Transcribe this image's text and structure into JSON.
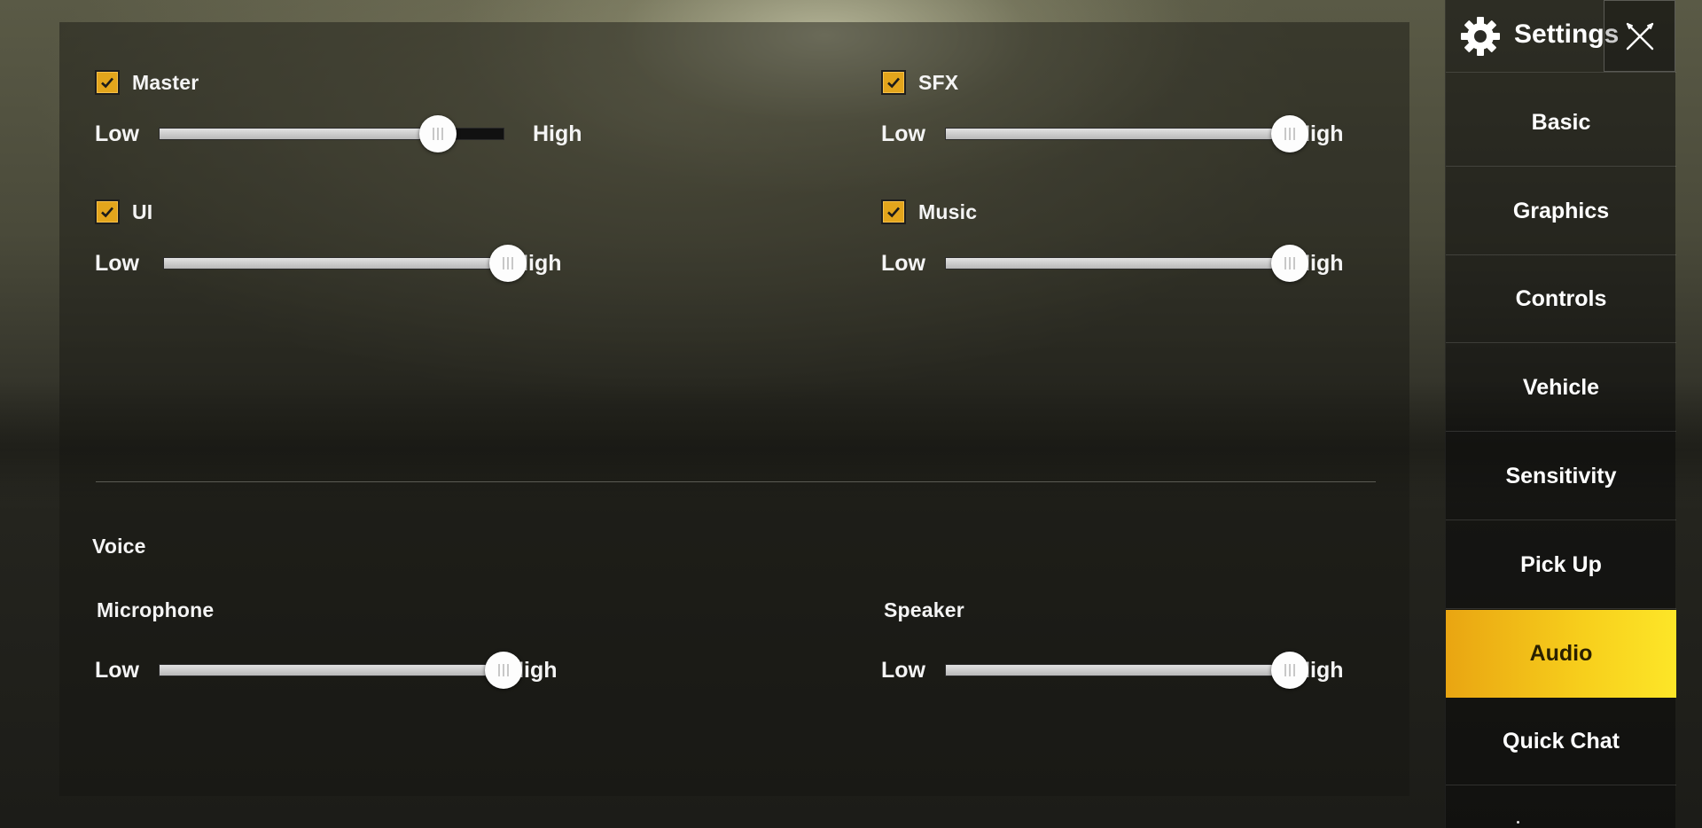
{
  "audio": {
    "master": {
      "label": "Master",
      "checked": true,
      "low": "Low",
      "high": "High",
      "level": 0.81
    },
    "sfx": {
      "label": "SFX",
      "checked": true,
      "low": "Low",
      "high": "High",
      "level": 1.0
    },
    "ui": {
      "label": "UI",
      "checked": true,
      "low": "Low",
      "high": "High",
      "level": 1.0
    },
    "music": {
      "label": "Music",
      "checked": true,
      "low": "Low",
      "high": "High",
      "level": 1.0
    }
  },
  "voice": {
    "section_label": "Voice",
    "microphone": {
      "label": "Microphone",
      "low": "Low",
      "high": "High",
      "level": 1.0
    },
    "speaker": {
      "label": "Speaker",
      "low": "Low",
      "high": "High",
      "level": 1.0
    }
  },
  "sidebar": {
    "title": "Settings",
    "header_icon": "gear-icon",
    "close_icon": "close-icon",
    "items": [
      {
        "label": "Basic",
        "active": false
      },
      {
        "label": "Graphics",
        "active": false
      },
      {
        "label": "Controls",
        "active": false
      },
      {
        "label": "Vehicle",
        "active": false
      },
      {
        "label": "Sensitivity",
        "active": false
      },
      {
        "label": "Pick Up",
        "active": false
      },
      {
        "label": "Audio",
        "active": true
      },
      {
        "label": "Quick Chat",
        "active": false
      }
    ]
  },
  "colors": {
    "accent": "#f5c518",
    "checkbox": "#e3a51c",
    "track_fill": "#cfcfcf",
    "track_empty": "#111111"
  }
}
